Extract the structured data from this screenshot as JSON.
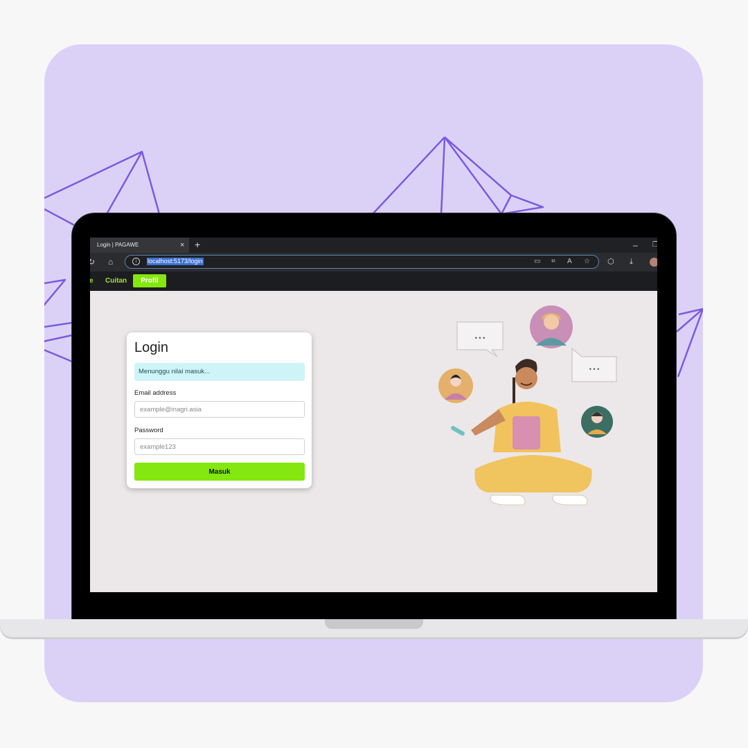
{
  "browser": {
    "tab_title": "Login | PAGAWE",
    "tab_close": "×",
    "new_tab": "+",
    "url": "localhost:5173/login",
    "window_min": "–"
  },
  "app_nav": {
    "items": [
      {
        "label": "e"
      },
      {
        "label": "Cuitan"
      },
      {
        "label": "Profil",
        "active": true
      }
    ]
  },
  "login": {
    "title": "Login",
    "status_message": "Menunggu nilai masuk...",
    "email_label": "Email address",
    "email_placeholder": "example@inagri.asia",
    "password_label": "Password",
    "password_placeholder": "example123",
    "submit_label": "Masuk"
  },
  "colors": {
    "background_lavender": "#dbd1f7",
    "accent_green": "#84e70f",
    "alert_bg": "#cff4f7",
    "deco_lines": "#7b5ae0"
  },
  "illustration": {
    "speech_bubble_text": "• • •"
  }
}
